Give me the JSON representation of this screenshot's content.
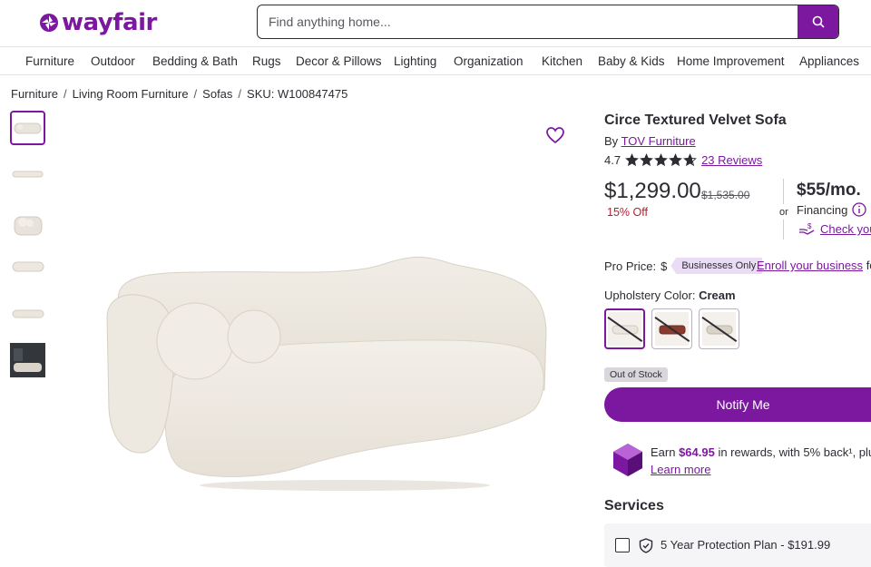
{
  "header": {
    "logo_text": "wayfair",
    "search_placeholder": "Find anything home..."
  },
  "nav": [
    "Furniture",
    "Outdoor",
    "Bedding & Bath",
    "Rugs",
    "Decor & Pillows",
    "Lighting",
    "Organization",
    "Kitchen",
    "Baby & Kids",
    "Home Improvement",
    "Appliances"
  ],
  "breadcrumb": {
    "items": [
      "Furniture",
      "Living Room Furniture",
      "Sofas"
    ],
    "sku": "SKU: W100847475"
  },
  "product": {
    "title": "Circe Textured Velvet Sofa",
    "by_label": "By",
    "brand": "TOV Furniture",
    "rating": "4.7",
    "rating_value": 4.7,
    "stars_max": 5,
    "reviews": "23 Reviews",
    "price": "$1,299.00",
    "old_price": "$1,535.00",
    "discount": "15% Off",
    "or_label": "or",
    "monthly": "$55/mo.",
    "financing": "Financing",
    "check_your": "Check you",
    "pro_price_label": "Pro Price:",
    "pro_price_symbol": "$",
    "businesses_only": "Businesses Only",
    "enroll": "Enroll your business",
    "enroll_suffix": "fo",
    "color_label": "Upholstery Color:",
    "color_value": "Cream",
    "swatches": [
      {
        "name": "Cream",
        "color": "#ebe6dd",
        "selected": true
      },
      {
        "name": "Rust",
        "color": "#8a3b2f",
        "selected": false
      },
      {
        "name": "Beige",
        "color": "#d8d2c7",
        "selected": false
      }
    ],
    "stock_badge": "Out of Stock",
    "notify_button": "Notify Me",
    "rewards_prefix": "Earn ",
    "rewards_amount": "$64.95",
    "rewards_suffix": " in rewards, with 5% back¹, plu",
    "learn_more": "Learn more",
    "services_title": "Services",
    "protection_plan": "5 Year Protection Plan - $191.99"
  },
  "colors": {
    "brand": "#7b189f",
    "text": "#2f2b33",
    "discount": "#b51f2e",
    "badge_bg": "#e9dcf4"
  },
  "icons": [
    "search-icon",
    "heart-icon",
    "star-icon",
    "info-icon",
    "hand-money-icon",
    "rewards-gem-icon",
    "shield-icon"
  ]
}
